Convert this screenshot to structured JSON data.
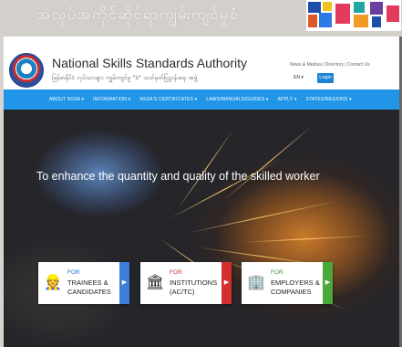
{
  "outer": {
    "title": "အလုပ်အကိုင်ဆိုင်ရာကျွမ်းကျင်မှုစံ"
  },
  "header": {
    "title": "National Skills Standards Authority",
    "subtitle": "မြန်မာနိုင်ငံ လုပ်သားများ ကျွမ်းကျင်မှု \"ခံ\" သတ်မှတ်ပြဋ္ဌာန်းရေး အဖွဲ့",
    "util_links": "News & Medias | Directory | Contact Us",
    "lang": "EN ▾",
    "login": "Login"
  },
  "nav": [
    "ABOUT NSSA ▾",
    "INFORMATION ▾",
    "NSSA'S CERTIFICATES ▾",
    "LAWS/MANUALS/GUIDES ▾",
    "APPLY ▾",
    "STATES/REGIONS ▾"
  ],
  "hero": {
    "tagline": "To enhance the quantity and quality of the skilled worker"
  },
  "cards": [
    {
      "for": "FOR",
      "line1": "TRAINEES &",
      "line2": "CANDIDATES",
      "icon": "worker-icon",
      "for_color": "#1b6fd6",
      "accent": "#3d7fd8"
    },
    {
      "for": "FOR",
      "line1": "INSTITUTIONS",
      "line2": "(AC/TC)",
      "icon": "institution-icon",
      "for_color": "#d32f2f",
      "accent": "#d32f2f"
    },
    {
      "for": "FOR",
      "line1": "EMPLOYERS &",
      "line2": "COMPANIES",
      "icon": "company-icon",
      "for_color": "#3f9a2f",
      "accent": "#4aa83a"
    }
  ],
  "colors": {
    "nav": "#2196e8",
    "login": "#1b83d6"
  }
}
